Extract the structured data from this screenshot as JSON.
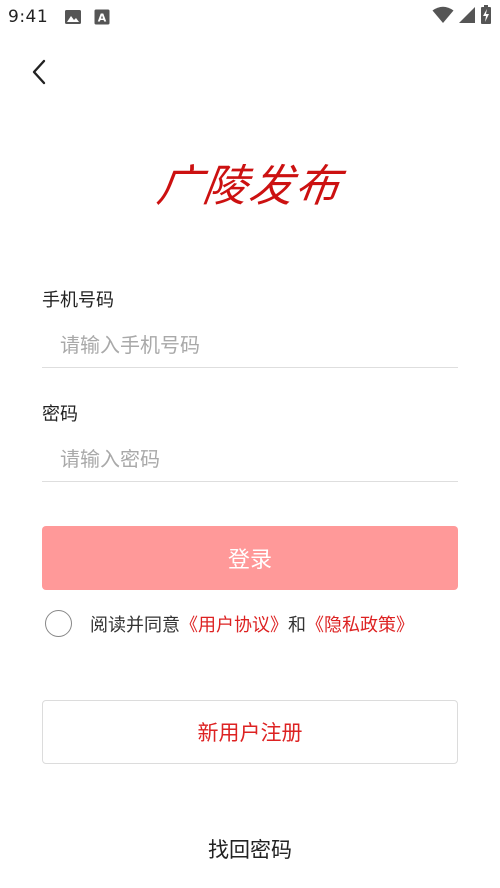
{
  "status_bar": {
    "time": "9:41",
    "icons": [
      "image-icon",
      "font-icon",
      "wifi-icon",
      "signal-icon",
      "battery-icon"
    ]
  },
  "nav": {
    "back_icon": "chevron-left-icon"
  },
  "logo": {
    "text": "广陵发布",
    "color": "#cc1111"
  },
  "form": {
    "phone": {
      "label": "手机号码",
      "placeholder": "请输入手机号码",
      "value": ""
    },
    "password": {
      "label": "密码",
      "placeholder": "请输入密码",
      "value": ""
    },
    "login_label": "登录"
  },
  "agreement": {
    "prefix": "阅读并同意",
    "user_agreement": "《用户协议》",
    "joiner": "和",
    "privacy_policy": "《隐私政策》",
    "checked": false
  },
  "register_label": "新用户注册",
  "forgot_label": "找回密码",
  "colors": {
    "accent": "#dd2222",
    "login_button": "#ff9999",
    "divider": "#dedede"
  }
}
